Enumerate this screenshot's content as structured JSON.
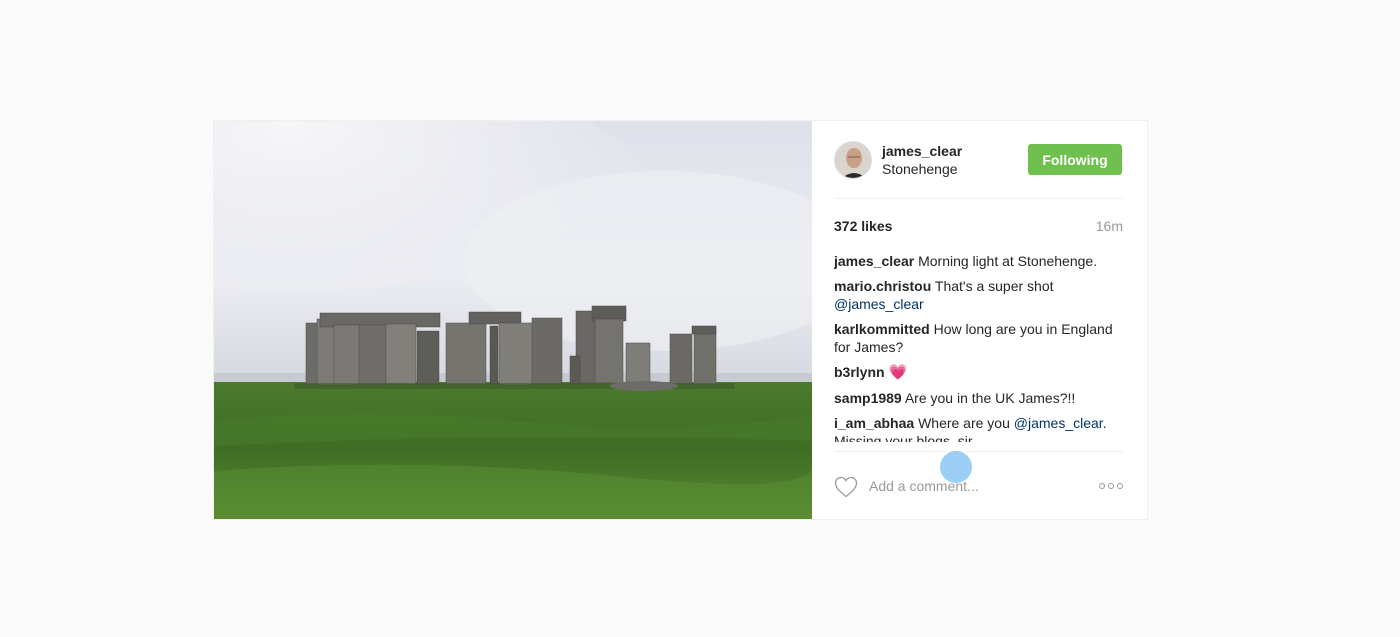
{
  "post": {
    "image_alt": "Stonehenge",
    "author": {
      "username": "james_clear",
      "location": "Stonehenge",
      "avatar_icon": "user-avatar"
    },
    "follow_button_label": "Following",
    "likes_text": "372 likes",
    "age": "16m",
    "comments": [
      {
        "user": "james_clear",
        "text": "Morning light at Stonehenge.",
        "mention": "",
        "after": ""
      },
      {
        "user": "mario.christou",
        "text": "That's a super shot ",
        "mention": "@james_clear",
        "after": ""
      },
      {
        "user": "karlkommitted",
        "text": "How long are you in England for James?",
        "mention": "",
        "after": ""
      },
      {
        "user": "b3rlynn",
        "text": "",
        "mention": "",
        "after": "",
        "emoji": "💗"
      },
      {
        "user": "samp1989",
        "text": "Are you in the UK James?!!",
        "mention": "",
        "after": ""
      },
      {
        "user": "i_am_abhaa",
        "text": "Where are you ",
        "mention": "@james_clear",
        "after": ". Missing your blogs, sir."
      }
    ],
    "comment_placeholder": "Add a comment...",
    "heart_icon": "heart-outline-icon",
    "more_icon": "more-options-icon"
  },
  "colors": {
    "follow_button": "#70c050",
    "mention": "#003569",
    "muted": "#999999"
  }
}
